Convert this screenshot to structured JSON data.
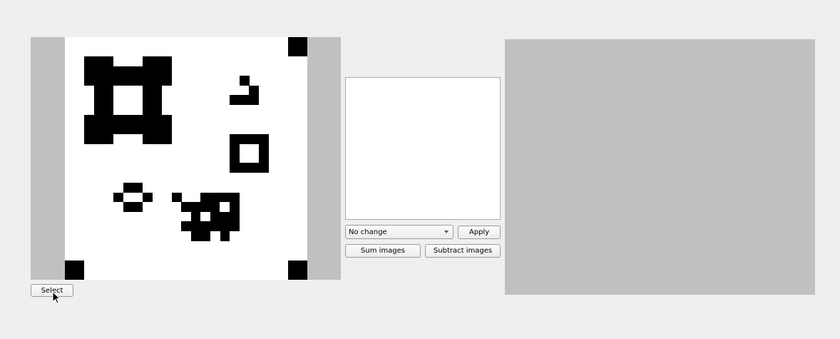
{
  "source_image": {
    "name": "source-image-panel"
  },
  "controls": {
    "select_label": "Select",
    "operation_value": "No change",
    "apply_label": "Apply",
    "sum_label": "Sum images",
    "subtract_label": "Subtract images"
  },
  "icons": {
    "cursor": "mouse-pointer-icon",
    "dropdown": "chevron-down-icon"
  },
  "colors": {
    "panel_bg": "#c0c0c0",
    "canvas_bg": "#ffffff",
    "pixel": "#000000",
    "window_bg": "#efefef"
  }
}
